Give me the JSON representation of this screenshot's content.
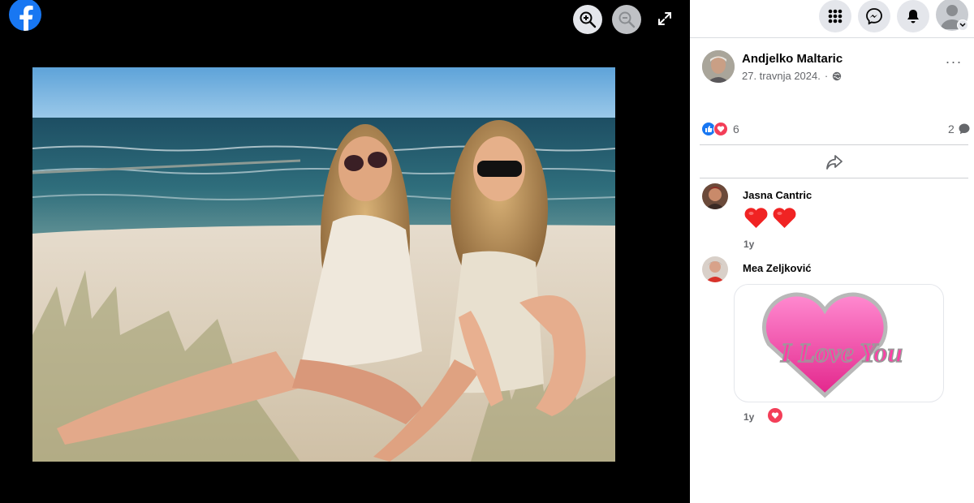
{
  "viewer": {
    "logo_icon": "facebook-logo",
    "controls": {
      "zoom_in_icon": "zoom-in-icon",
      "zoom_out_icon": "zoom-out-icon",
      "fullscreen_icon": "fullscreen-icon"
    }
  },
  "topbar": {
    "menu_icon": "grid-menu-icon",
    "messenger_icon": "messenger-icon",
    "notifications_icon": "bell-icon",
    "account_icon": "profile-icon"
  },
  "post": {
    "author": "Andjelko Maltaric",
    "date": "27. travnja 2024.",
    "separator": "·",
    "audience_icon": "globe-icon",
    "more_label": "···"
  },
  "stats": {
    "reaction_types": [
      "like",
      "love"
    ],
    "reaction_count": "6",
    "comment_count": "2"
  },
  "actions": {
    "share_icon": "share-icon"
  },
  "comments": [
    {
      "author": "Jasna Cantric",
      "content_icons": [
        "heart",
        "heart"
      ],
      "time": "1y"
    },
    {
      "author": "Mea Zeljković",
      "sticker_text": "I Love You",
      "time": "1y",
      "reaction": "love"
    }
  ],
  "colors": {
    "brand": "#1877f2",
    "love": "#f33e58",
    "sticker_pink": "#ff4fb3"
  }
}
